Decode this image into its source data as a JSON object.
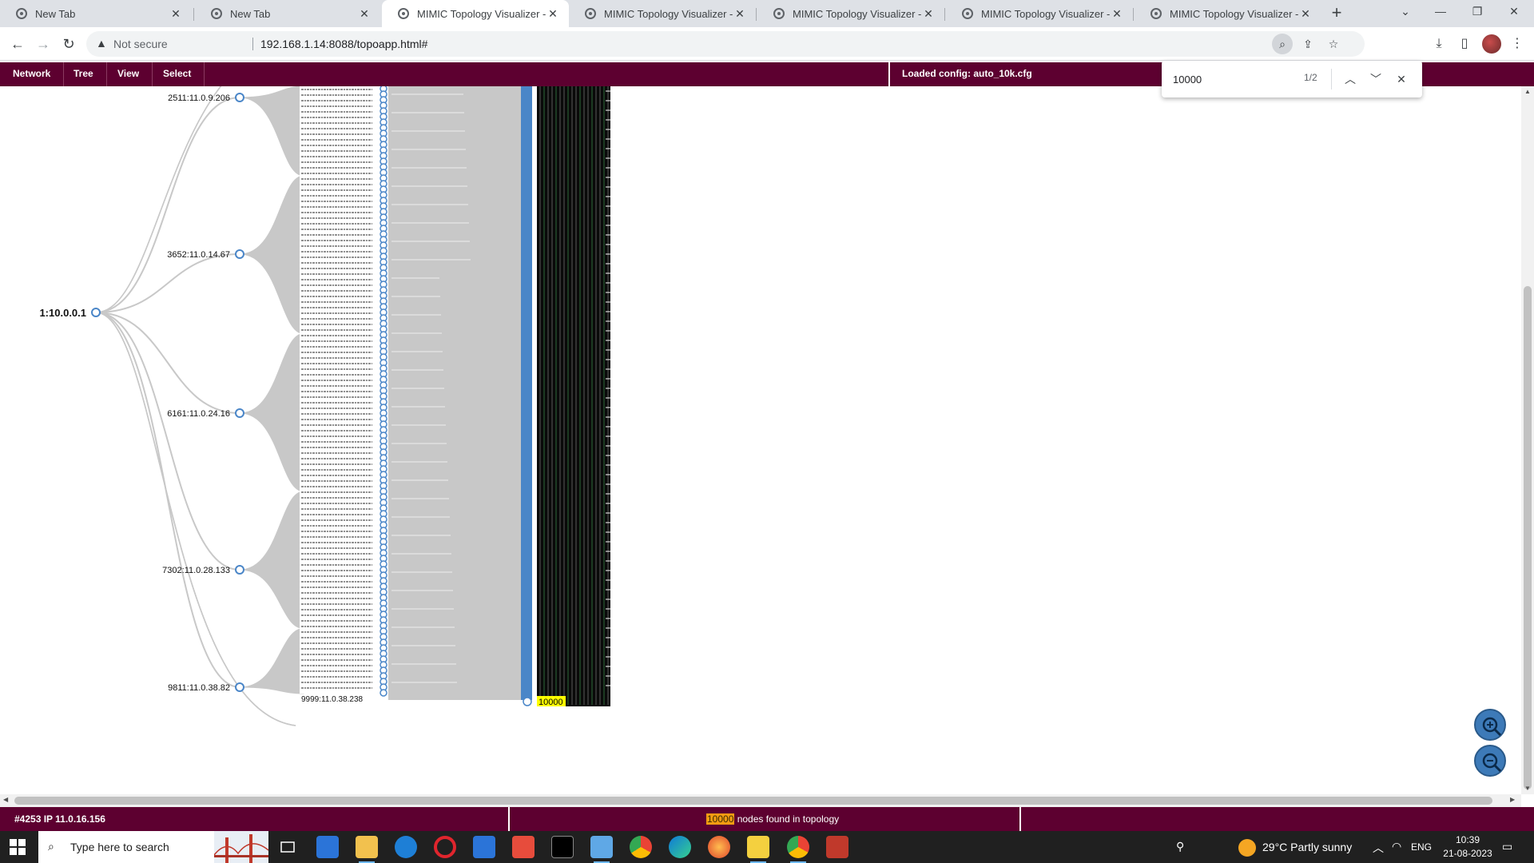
{
  "browser": {
    "tabs": [
      {
        "label": "New Tab",
        "active": false
      },
      {
        "label": "New Tab",
        "active": false
      },
      {
        "label": "MIMIC Topology Visualizer - 192",
        "active": true
      },
      {
        "label": "MIMIC Topology Visualizer - 192",
        "active": false
      },
      {
        "label": "MIMIC Topology Visualizer - 192",
        "active": false
      },
      {
        "label": "MIMIC Topology Visualizer - 192",
        "active": false
      },
      {
        "label": "MIMIC Topology Visualizer - 192",
        "active": false
      }
    ],
    "security_label": "Not secure",
    "url": "192.168.1.14:8088/topoapp.html#"
  },
  "find": {
    "query": "10000",
    "count": "1/2"
  },
  "app": {
    "menus": [
      "Network",
      "Tree",
      "View",
      "Select"
    ],
    "config_label": "Loaded config: auto_10k.cfg"
  },
  "topology": {
    "root": "1:10.0.0.1",
    "children": [
      "2511:11.0.9.206",
      "3652:11.0.14.67",
      "6161:11.0.24.16",
      "7302:11.0.28.133",
      "9811:11.0.38.82"
    ],
    "last_grandchild": "9999:11.0.38.238",
    "search_match_label": "10000",
    "link_color": "#c8c8c8",
    "node_stroke": "#4a86c8",
    "match_highlight": "#ffff00"
  },
  "status": {
    "left": "#4253  IP 11.0.16.156",
    "match_count": "10000",
    "match_suffix": " nodes found in topology",
    "highlight_color": "#f39c12"
  },
  "taskbar": {
    "search_placeholder": "Type here to search",
    "weather": "29°C  Partly sunny",
    "lang": "ENG",
    "time": "10:39",
    "date": "21-08-2023"
  },
  "colors": {
    "app_bar": "#5d0030",
    "zoom_button": "#3d7ab8"
  }
}
